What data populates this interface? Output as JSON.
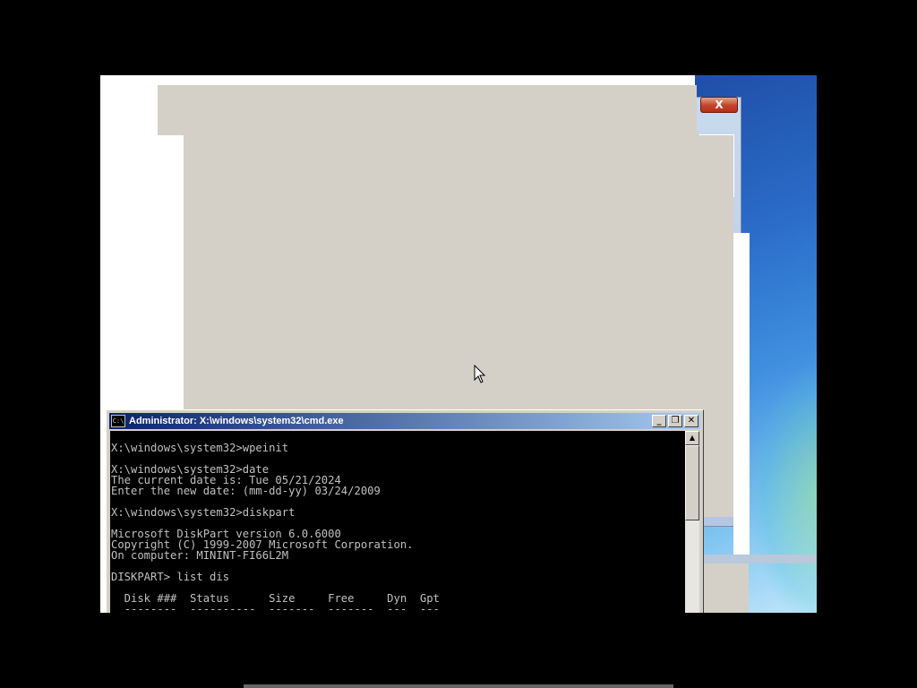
{
  "cmd": {
    "title": "Administrator: X:\\windows\\system32\\cmd.exe",
    "app_icon_text": "C:\\",
    "lines": [
      "X:\\windows\\system32>wpeinit",
      "",
      "X:\\windows\\system32>date",
      "The current date is: Tue 05/21/2024",
      "Enter the new date: (mm-dd-yy) 03/24/2009",
      "",
      "X:\\windows\\system32>diskpart",
      "",
      "Microsoft DiskPart version 6.0.6000",
      "Copyright (C) 1999-2007 Microsoft Corporation.",
      "On computer: MININT-FI66L2M",
      "",
      "DISKPART> list dis",
      "",
      "  Disk ###  Status      Size     Free     Dyn  Gpt",
      "  --------  ----------  -------  -------  ---  ---"
    ],
    "buttons": {
      "minimize": "_",
      "restore": "❐",
      "close": "✕"
    }
  },
  "background_dialog": {
    "close_glyph": "X"
  },
  "colors": {
    "console_bg": "#000000",
    "console_fg": "#c0c0c0",
    "title_gradient_start": "#0a246a",
    "title_gradient_end": "#a6caf0",
    "window_gray": "#d4d0c8"
  }
}
